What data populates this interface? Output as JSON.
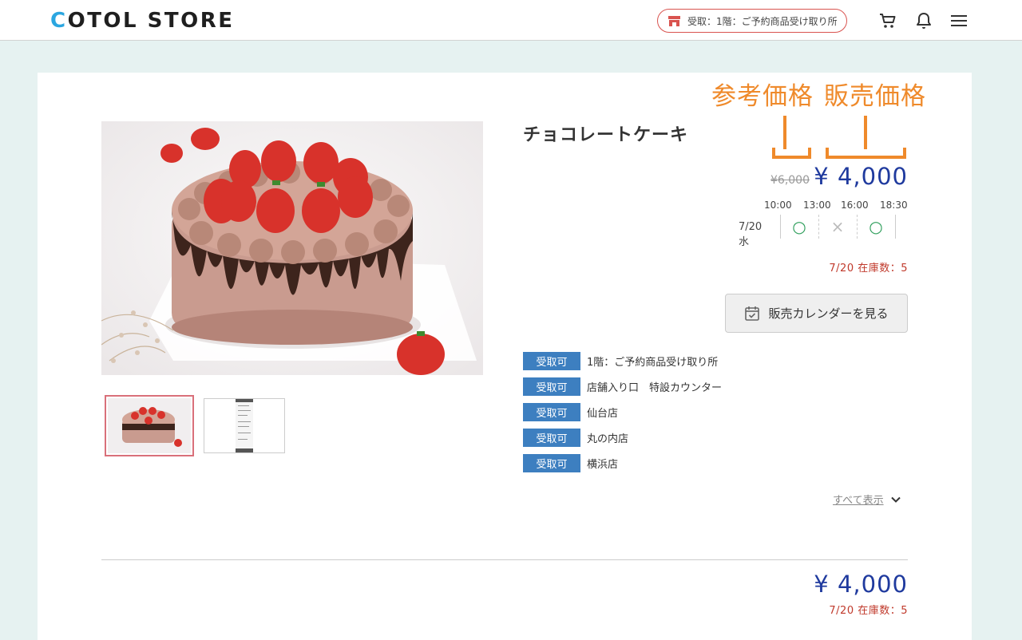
{
  "header": {
    "logo_first": "C",
    "logo_rest": "OTOL STORE",
    "pickup_label": "受取：1階：ご予約商品受け取り所"
  },
  "annotations": {
    "reference_price_label": "参考価格",
    "sale_price_label": "販売価格"
  },
  "product": {
    "title": "チョコレートケーキ",
    "reference_price": "¥6,000",
    "sale_price": "¥ 4,000",
    "slot_times": [
      "10:00",
      "13:00",
      "16:00",
      "18:30"
    ],
    "slot_date": "7/20水",
    "slot_status": [
      "○",
      "×",
      "○"
    ],
    "stock_text": "7/20 在庫数：5",
    "calendar_button": "販売カレンダーを見る",
    "locations": [
      {
        "badge": "受取可",
        "name": "1階：ご予約商品受け取り所"
      },
      {
        "badge": "受取可",
        "name": "店舗入り口　特設カウンター"
      },
      {
        "badge": "受取可",
        "name": "仙台店"
      },
      {
        "badge": "受取可",
        "name": "丸の内店"
      },
      {
        "badge": "受取可",
        "name": "横浜店"
      }
    ],
    "show_all": "すべて表示"
  },
  "footer": {
    "total_price": "¥ 4,000",
    "stock_text": "7/20 在庫数：5"
  },
  "colors": {
    "accent_blue": "#1f3a9e",
    "badge_blue": "#3d7fc0",
    "annotation_orange": "#ef8a2b",
    "stock_red": "#c0392b",
    "available_green": "#2e9e5b"
  }
}
